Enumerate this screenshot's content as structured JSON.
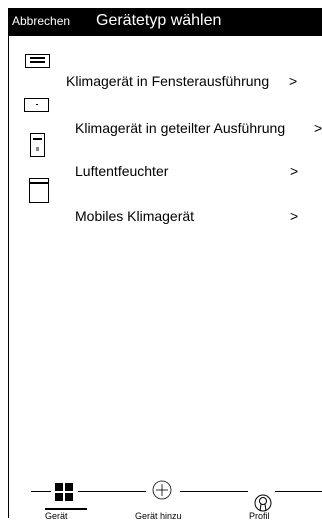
{
  "header": {
    "cancel_label": "Abbrechen",
    "title": "Gerätetyp wählen"
  },
  "device_types": [
    {
      "label": "Klimagerät in Fensterausführung",
      "arrow": ">",
      "icon": "window-ac-icon"
    },
    {
      "label": "Klimagerät in geteilter Ausführung",
      "arrow": ">",
      "icon": "split-ac-icon"
    },
    {
      "label": "Luftentfeuchter",
      "arrow": ">",
      "icon": "dehumidifier-icon"
    },
    {
      "label": "Mobiles Klimagerät",
      "arrow": ">",
      "icon": "portable-ac-icon"
    }
  ],
  "tabbar": {
    "device_label": "Gerät",
    "add_label": "Gerät hinzu",
    "profile_label": "Profil",
    "device_icon": "grid-icon",
    "add_icon": "plus-circle-icon",
    "profile_icon": "profile-icon"
  },
  "colors": {
    "header_background": "#000000",
    "header_text": "#ffffff",
    "background": "#ffffff"
  }
}
